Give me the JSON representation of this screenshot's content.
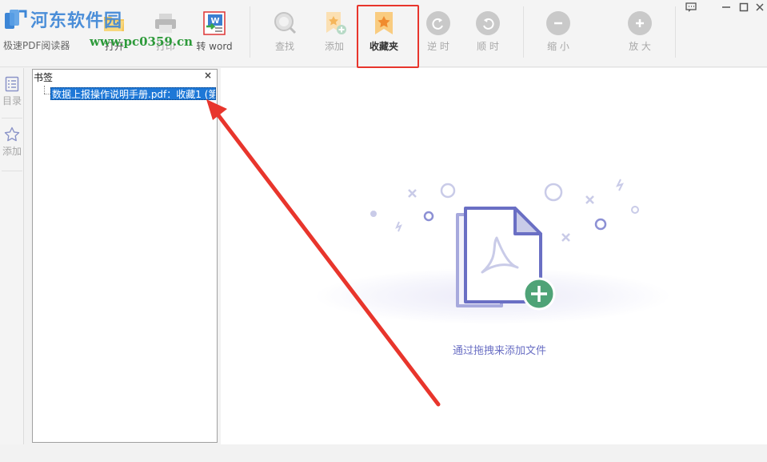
{
  "watermark": {
    "site_name": "河东软件园",
    "site_url": "www.pc0359.cn",
    "app_name_partial": "极速PDF阅读器"
  },
  "toolbar": {
    "buttons": [
      {
        "label": "打开",
        "icon": "folder-open-icon",
        "state": "normal"
      },
      {
        "label": "打印",
        "icon": "printer-icon",
        "state": "disabled"
      },
      {
        "label": "转 word",
        "icon": "convert-word-icon",
        "state": "normal"
      },
      {
        "label": "查找",
        "icon": "search-icon",
        "state": "disabled"
      },
      {
        "label": "添加",
        "icon": "add-bookmark-icon",
        "state": "disabled"
      },
      {
        "label": "收藏夹",
        "icon": "favorites-star-icon",
        "state": "selected"
      },
      {
        "label": "逆 时",
        "icon": "rotate-ccw-icon",
        "state": "disabled"
      },
      {
        "label": "顺 时",
        "icon": "rotate-cw-icon",
        "state": "disabled"
      },
      {
        "label": "缩 小",
        "icon": "zoom-out-icon",
        "state": "disabled"
      },
      {
        "label": "放 大",
        "icon": "zoom-in-icon",
        "state": "disabled"
      }
    ]
  },
  "window_controls": [
    "feedback-icon",
    "minimize-icon",
    "maximize-icon",
    "close-icon"
  ],
  "sidebar": {
    "items": [
      {
        "label": "目录",
        "icon": "toc-list-icon"
      },
      {
        "label": "添加",
        "icon": "star-outline-icon"
      }
    ]
  },
  "bookmark_panel": {
    "title": "书签",
    "close_glyph": "×",
    "items": [
      "数据上报操作说明手册.pdf：收藏1 (第"
    ]
  },
  "main": {
    "empty_hint": "通过拖拽来添加文件"
  },
  "colors": {
    "highlight_box": "#e8352c",
    "arrow": "#e8352c",
    "selection": "#1e78d7",
    "accent_purple": "#6a6fc4",
    "plus_green": "#4fa377"
  }
}
